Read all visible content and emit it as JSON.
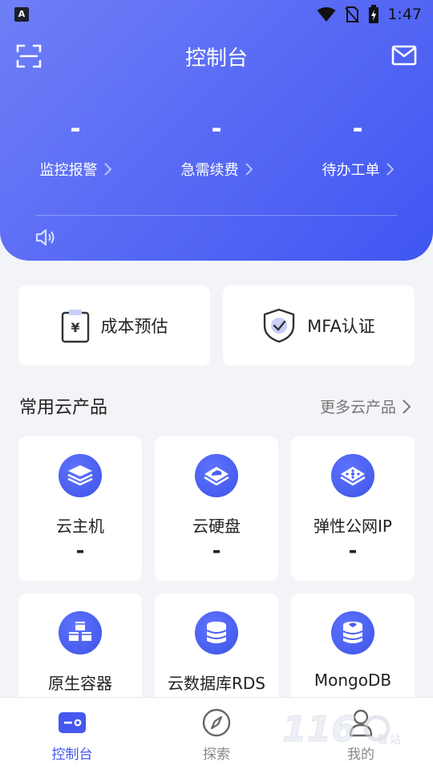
{
  "status_bar": {
    "app_badge": "A",
    "time": "1:47"
  },
  "header": {
    "title": "控制台"
  },
  "stats": [
    {
      "value": "-",
      "label": "监控报警"
    },
    {
      "value": "-",
      "label": "急需续费"
    },
    {
      "value": "-",
      "label": "待办工单"
    }
  ],
  "quick_actions": [
    {
      "label": "成本预估",
      "icon": "cost-estimate-icon"
    },
    {
      "label": "MFA认证",
      "icon": "shield-check-icon"
    }
  ],
  "products_section": {
    "title": "常用云产品",
    "more_label": "更多云产品"
  },
  "products": [
    {
      "name": "云主机",
      "value": "-",
      "icon": "layers-icon"
    },
    {
      "name": "云硬盘",
      "value": "-",
      "icon": "cloud-disk-icon"
    },
    {
      "name": "弹性公网IP",
      "value": "-",
      "icon": "network-ip-icon"
    },
    {
      "name": "原生容器",
      "value": "",
      "icon": "containers-icon"
    },
    {
      "name": "云数据库RDS",
      "value": "",
      "icon": "database-icon"
    },
    {
      "name": "MongoDB",
      "value": "",
      "icon": "mongodb-icon"
    }
  ],
  "bottom_nav": [
    {
      "label": "控制台",
      "icon": "console-icon",
      "active": true
    },
    {
      "label": "探索",
      "icon": "compass-icon",
      "active": false
    },
    {
      "label": "我的",
      "icon": "user-icon",
      "active": false
    }
  ],
  "watermark": {
    "text": "116",
    "suffix": "载站"
  },
  "colors": {
    "accent": "#4557ee",
    "header_start": "#6f7ff7",
    "header_end": "#4056f2",
    "background": "#f3f4f8"
  }
}
